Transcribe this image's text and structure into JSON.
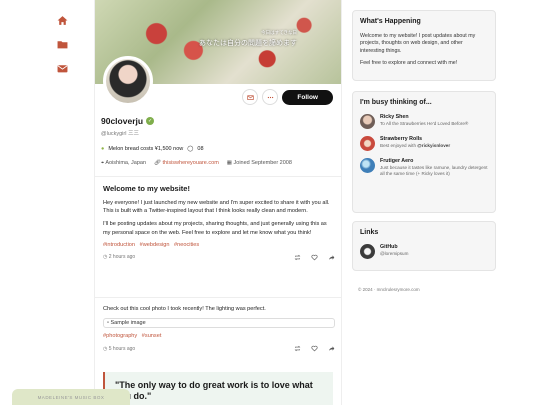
{
  "nav": {
    "home": "home-icon",
    "folder": "folder-icon",
    "mail": "mail-icon"
  },
  "banner": {
    "caption_small": "今日はすてきな日",
    "caption": "あなたは自分の問題を諦めます"
  },
  "profile": {
    "name": "90cloverju",
    "handle": "@luckygirl 三三",
    "status": "Melon bread costs ¥1,500 now",
    "status_count": "08",
    "location": "Aoishima, Japan",
    "website": "thisiswhereyouare.com",
    "joined": "Joined September 2008",
    "follow_label": "Follow"
  },
  "posts": [
    {
      "title": "Welcome to my website!",
      "p1": "Hey everyone! I just launched my new website and I'm super excited to share it with you all. This is built with a Twitter-inspired layout that I think looks really clean and modern.",
      "p2": "I'll be posting updates about my projects, sharing thoughts, and just generally using this as my personal space on the web. Feel free to explore and let me know what you think!",
      "tags": [
        "#introduction",
        "#webdesign",
        "#neocities"
      ],
      "time": "2 hours ago"
    },
    {
      "text": "Check out this cool photo I took recently! The lighting was perfect.",
      "img_alt": "Sample image",
      "tags": [
        "#photography",
        "#sunset"
      ],
      "time": "5 hours ago"
    }
  ],
  "quote": "\"The only way to do great work is to love what you do.\"",
  "sidebar": {
    "happening": {
      "title": "What's Happening",
      "p1": "Welcome to my website! I post updates about my projects, thoughts on web design, and other interesting things.",
      "p2": "Feel free to explore and connect with me!"
    },
    "thinking": {
      "title": "I'm busy thinking of...",
      "items": [
        {
          "title": "Ricky Shen",
          "desc": "To All the Strawberries He'd Loved Before®",
          "color": "#7a6a63"
        },
        {
          "title": "Strawberry Rolls",
          "desc": "Best enjoyed with",
          "mention": "@rickyisnlover",
          "color": "#c94a3d"
        },
        {
          "title": "Frutiger Aero",
          "desc": "Just because it tastes like ramune, laundry detergent all the same time (+ Ricky loves it)",
          "color": "#3f7fb8"
        }
      ]
    },
    "links": {
      "title": "Links",
      "items": [
        {
          "title": "GitHub",
          "desc": "@loremipsum"
        }
      ]
    },
    "footer": "© 2024 · mnclrulesrymore.com"
  },
  "music": "MADELEINE'S MUSIC BOX"
}
